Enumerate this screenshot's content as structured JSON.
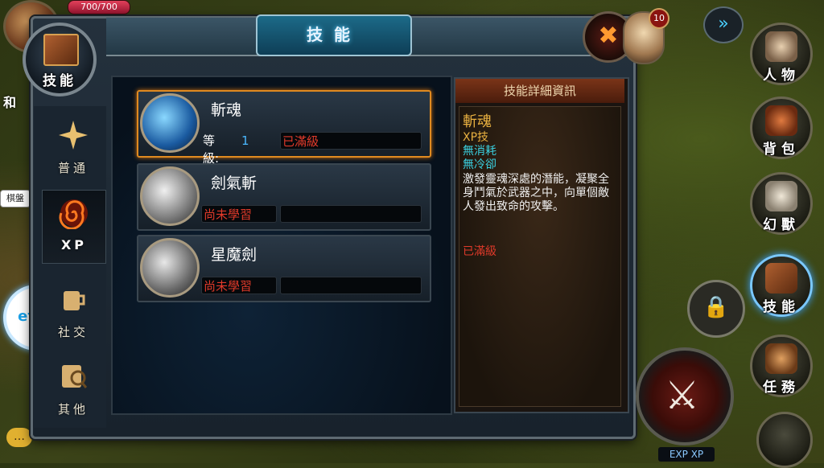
{
  "hud": {
    "hp": "700/700",
    "level": "10",
    "exp_label": "EXP XP",
    "side_label": "棋盤",
    "side_label2": "和"
  },
  "window": {
    "title": "技能",
    "close_icon": "✖"
  },
  "badge": {
    "label": "技能"
  },
  "tabs": [
    {
      "label": "普通",
      "icon": "star-burst-icon"
    },
    {
      "label": "XP",
      "icon": "spiral-icon"
    },
    {
      "label": "社交",
      "icon": "mug-icon"
    },
    {
      "label": "其他",
      "icon": "scroll-icon"
    }
  ],
  "skills": [
    {
      "name": "斬魂",
      "level_label": "等級:",
      "level_value": "1",
      "status": "已滿級",
      "selected": true
    },
    {
      "name": "劍氣斬",
      "status": "尚未學習"
    },
    {
      "name": "星魔劍",
      "status": "尚未學習"
    }
  ],
  "detail": {
    "header": "技能詳細資訊",
    "name": "斬魂",
    "type": "XP技",
    "cost": "無消耗",
    "cooldown": "無冷卻",
    "description": "激發靈魂深處的潛能，凝聚全身鬥氣於武器之中，向單個敵人發出致命的攻擊。",
    "status": "已滿級"
  },
  "right_menu": [
    {
      "label": "人物",
      "icon": "character-icon"
    },
    {
      "label": "背包",
      "icon": "bag-icon"
    },
    {
      "label": "幻獸",
      "icon": "unicorn-icon"
    },
    {
      "label": "技能",
      "icon": "skill-book-icon"
    },
    {
      "label": "任務",
      "icon": "quest-scroll-icon"
    }
  ],
  "colors": {
    "selected_border": "#e08a20",
    "cyan": "#3ad0e0",
    "red": "#e03a2a",
    "gold": "#e8b040"
  }
}
